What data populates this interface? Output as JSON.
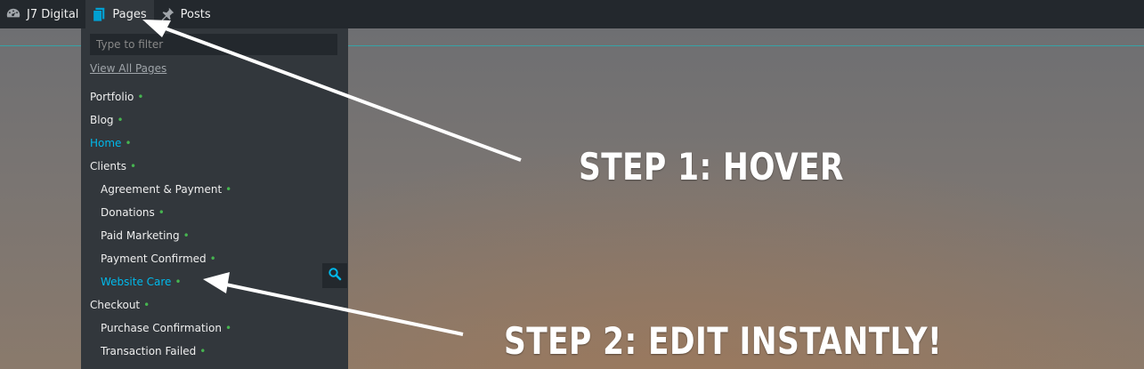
{
  "adminbar": {
    "site_name": "J7 Digital",
    "pages_label": "Pages",
    "posts_label": "Posts",
    "icons": {
      "site": "dashboard-icon",
      "pages": "pages-icon",
      "posts": "pin-icon"
    }
  },
  "dropdown": {
    "filter_placeholder": "Type to filter",
    "view_all_label": "View All Pages",
    "items": [
      {
        "label": "Portfolio",
        "dot": "•"
      },
      {
        "label": "Blog",
        "dot": "•"
      },
      {
        "label": "Home",
        "dot": "•"
      },
      {
        "label": "Clients",
        "dot": "•"
      },
      {
        "label": "Agreement & Payment",
        "dot": "•"
      },
      {
        "label": "Donations",
        "dot": "•"
      },
      {
        "label": "Paid Marketing",
        "dot": "•"
      },
      {
        "label": "Payment Confirmed",
        "dot": "•"
      },
      {
        "label": "Website Care",
        "dot": "•"
      },
      {
        "label": "Checkout",
        "dot": "•"
      },
      {
        "label": "Purchase Confirmation",
        "dot": "•"
      },
      {
        "label": "Transaction Failed",
        "dot": "•"
      }
    ]
  },
  "annotations": {
    "step1": "STEP 1: HOVER",
    "step2": "STEP 2: EDIT INSTANTLY!"
  },
  "colors": {
    "adminbar_bg": "#23282d",
    "dropdown_bg": "#32373c",
    "link_active": "#00b9eb",
    "status_dot": "#46b450",
    "pages_icon": "#00a0d2"
  }
}
